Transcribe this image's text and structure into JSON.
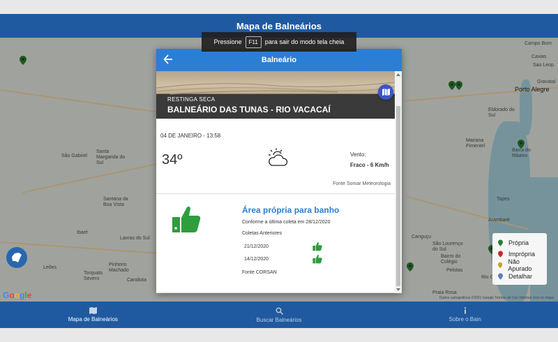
{
  "app": {
    "title": "Mapa de Balneários"
  },
  "fullscreen_notice": {
    "prefix": "Pressione",
    "key": "F11",
    "suffix": "para sair do modo tela cheia"
  },
  "map": {
    "cities": [
      "São Gabriel",
      "Santa Margarida do Sul",
      "Santana da Boa Vista",
      "Pinheiro Machado",
      "Ibaré",
      "Lavras do Sul",
      "Leões",
      "Torquato Severo",
      "Candiota",
      "Campo Bom",
      "Caxias",
      "Sao Leop",
      "Porto Alegre",
      "Gravataí",
      "Eldorado do Sul",
      "Mariana Pimentel",
      "Barra do Ribeiro",
      "Tapes",
      "Arambaré",
      "São Lourenço do Sul",
      "Canguçu",
      "Pelotas",
      "Bairro do Colégio",
      "Praia Rosa",
      "Rio Grande"
    ],
    "footer": "Dados cartográficos ©2021 Google   Termos de Uso   Informar erro no mapa",
    "google_logo": "Google"
  },
  "legend": {
    "items": [
      {
        "label": "Própria",
        "color": "#2e7d32"
      },
      {
        "label": "Imprópria",
        "color": "#c62828"
      },
      {
        "label": "Não Apurado",
        "color": "#c9a227"
      },
      {
        "label": "Detalhar",
        "color": "#5c7fbf"
      }
    ]
  },
  "modal": {
    "title": "Balneário",
    "region": "RESTINGA SECA",
    "name": "BALNEÁRIO DAS TUNAS - RIO VACACAÍ",
    "weather": {
      "date": "04 DE JANEIRO - 13:58",
      "temperature": "34º",
      "icon": "partly-cloudy-icon",
      "wind_label": "Vento:",
      "wind_value": "Fraco - 6 Km/h",
      "source": "Fonte Somar Meteorologia"
    },
    "quality": {
      "status": "Área própria para banho",
      "conform": "Conforme a última coleta em 28/12/2020",
      "previous_label": "Coletas Anteriores",
      "previous": [
        {
          "date": "21/12/2020",
          "result_icon": "thumb-up-icon"
        },
        {
          "date": "14/12/2020",
          "result_icon": "thumb-up-icon"
        }
      ],
      "source": "Fonte CORSAN"
    }
  },
  "nav": {
    "items": [
      {
        "label": "Mapa de Balneários",
        "icon": "map-icon"
      },
      {
        "label": "Buscar Balneários",
        "icon": "search-icon"
      },
      {
        "label": "Sobre o Bain",
        "icon": "info-icon"
      }
    ]
  },
  "colors": {
    "primary": "#1f5aa0",
    "modal_bar": "#2a7fd4",
    "good": "#2e9e3e"
  }
}
